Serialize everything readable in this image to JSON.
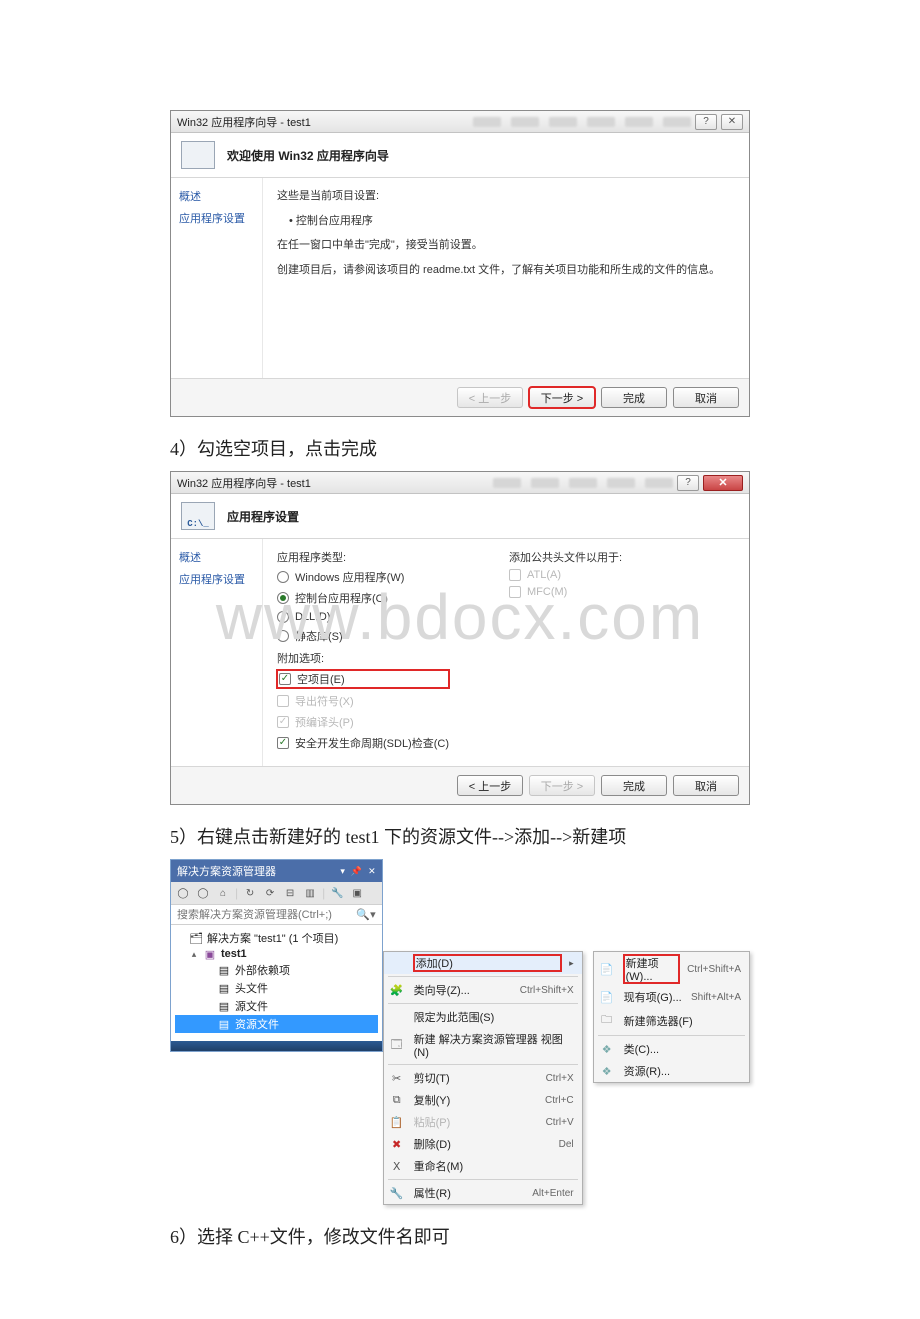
{
  "watermark": "www.bdocx.com",
  "dialog1": {
    "title": "Win32 应用程序向导 - test1",
    "header_title": "欢迎使用 Win32 应用程序向导",
    "sidebar": {
      "overview": "概述",
      "settings": "应用程序设置"
    },
    "content": {
      "line1": "这些是当前项目设置:",
      "bullet": "• 控制台应用程序",
      "line2": "在任一窗口中单击\"完成\"，接受当前设置。",
      "line3": "创建项目后，请参阅该项目的 readme.txt 文件，了解有关项目功能和所生成的文件的信息。"
    },
    "buttons": {
      "prev": "< 上一步",
      "next": "下一步 >",
      "finish": "完成",
      "cancel": "取消"
    }
  },
  "caption4": "4）勾选空项目，点击完成",
  "dialog2": {
    "title": "Win32 应用程序向导 - test1",
    "header_title": "应用程序设置",
    "header_icon_text": "C:\\_",
    "sidebar": {
      "overview": "概述",
      "settings": "应用程序设置"
    },
    "left": {
      "group": "应用程序类型:",
      "opt_win": "Windows 应用程序(W)",
      "opt_console": "控制台应用程序(O)",
      "opt_dll": "DLL(D)",
      "opt_static": "静态库(S)",
      "add_group": "附加选项:",
      "chk_empty": "空项目(E)",
      "chk_export": "导出符号(X)",
      "chk_pch": "预编译头(P)",
      "chk_sdl": "安全开发生命周期(SDL)检查(C)"
    },
    "right": {
      "group": "添加公共头文件以用于:",
      "chk_atl": "ATL(A)",
      "chk_mfc": "MFC(M)"
    },
    "buttons": {
      "prev": "< 上一步",
      "next": "下一步 >",
      "finish": "完成",
      "cancel": "取消"
    }
  },
  "caption5": "5）右键点击新建好的 test1 下的资源文件-->添加-->新建项",
  "explorer": {
    "title": "解决方案资源管理器",
    "search_placeholder": "搜索解决方案资源管理器(Ctrl+;)",
    "sln": "解决方案 \"test1\" (1 个项目)",
    "proj": "test1",
    "ext_deps": "外部依赖项",
    "headers": "头文件",
    "sources": "源文件",
    "resources": "资源文件"
  },
  "ctx1": {
    "add": "添加(D)",
    "classwiz": "类向导(Z)...",
    "classwiz_sc": "Ctrl+Shift+X",
    "scope": "限定为此范围(S)",
    "newsln": "新建 解决方案资源管理器 视图(N)",
    "cut": "剪切(T)",
    "cut_sc": "Ctrl+X",
    "copy": "复制(Y)",
    "copy_sc": "Ctrl+C",
    "paste": "粘贴(P)",
    "paste_sc": "Ctrl+V",
    "del": "删除(D)",
    "del_sc": "Del",
    "rename": "重命名(M)",
    "props": "属性(R)",
    "props_sc": "Alt+Enter"
  },
  "ctx2": {
    "newitem": "新建项(W)...",
    "newitem_sc": "Ctrl+Shift+A",
    "existing": "现有项(G)...",
    "existing_sc": "Shift+Alt+A",
    "newfilter": "新建筛选器(F)",
    "class": "类(C)...",
    "resource": "资源(R)..."
  },
  "caption6": "6）选择 C++文件，修改文件名即可"
}
